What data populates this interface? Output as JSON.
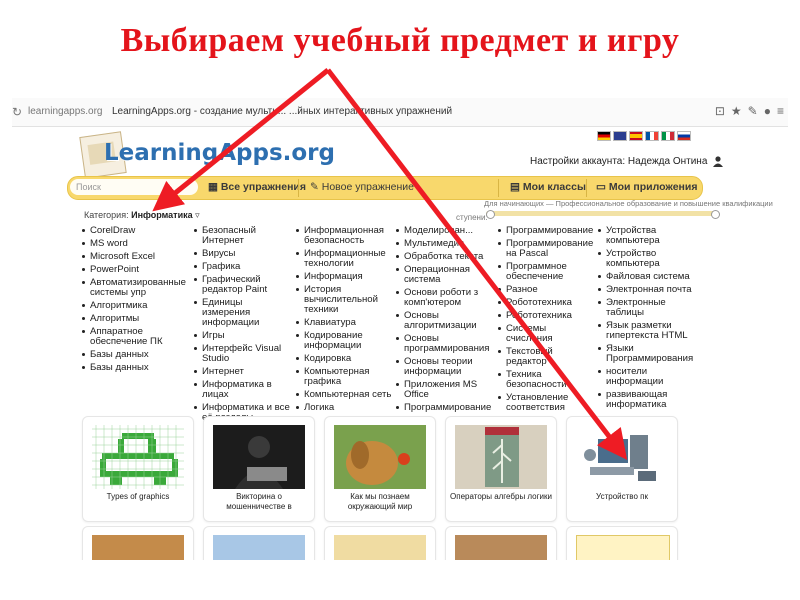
{
  "heading": "Выбираем учебный предмет и игру",
  "browser": {
    "url": "learningapps.org",
    "page_title": "LearningApps.org - создание мульти...",
    "page_title_tail": "...йных интерактивных упражнений"
  },
  "logo": {
    "text": "LearningApps.org"
  },
  "account": {
    "text": "Настройки аккаунта: Надежда Онтина"
  },
  "nav": {
    "search_placeholder": "Поиск",
    "all_exercises": "Все упражнения",
    "new_exercise": "Новое упражнение",
    "my_classes": "Мои классы",
    "my_apps": "Мои приложения"
  },
  "category": {
    "label": "Категория:",
    "value": "Информатика"
  },
  "levels": {
    "label": "Для начинающих — Профессиональное образование и повышение квалификации",
    "stage_label": "ступени:"
  },
  "topics": [
    [
      "CorelDraw",
      "MS word",
      "Microsoft Excel",
      "PowerPoint",
      "Автоматизированные системы упр",
      "Алгоритмика",
      "Алгоритмы",
      "Аппаратное обеспечение ПК",
      "Базы данных",
      "Базы данных"
    ],
    [
      "Безопасный Интернет",
      "Вирусы",
      "Графика",
      "Графический редактор Paint",
      "Единицы измерения информации",
      "Игры",
      "Интерфейс Visual Studio",
      "Интернет",
      "Информатика в лицах",
      "Информатика и все её разделы"
    ],
    [
      "Информационная безопасность",
      "Информационные технологии",
      "Информация",
      "История вычислительной техники",
      "Клавиатура",
      "Кодирование информации",
      "Кодировка",
      "Компьютерная графика",
      "Компьютерная сеть",
      "Логика"
    ],
    [
      "Моделирован...",
      "Мультимедиа",
      "Обработка текста",
      "Операционная система",
      "Основи роботи з комп'ютером",
      "Основы алгоритмизации",
      "Основы программирования",
      "Основы теории информации",
      "Приложения MS Office",
      "Программирование"
    ],
    [
      "Программирование",
      "Программирование на Pascal",
      "Программное обеспечение",
      "Разное",
      "Робототехника",
      "Робототехника",
      "Системы счисления",
      "Текстовый редактор",
      "Техника безопасности",
      "Установление соответствия"
    ],
    [
      "Устройства компьютера",
      "Устройство компьютера",
      "Файловая система",
      "Электронная почта",
      "Электронные таблицы",
      "Язык разметки гипертекста HTML",
      "Языки Программирования",
      "носители информации",
      "развивающая информатика"
    ]
  ],
  "tiles": [
    {
      "caption": "Types of graphics"
    },
    {
      "caption": "Викторина о мошенничестве в"
    },
    {
      "caption": "Как мы познаем окружающий мир"
    },
    {
      "caption": "Операторы алгебры логики"
    },
    {
      "caption": "Устройство пк"
    }
  ],
  "colors": {
    "heading": "#e4141b",
    "arrow": "#ee1c24",
    "navbar": "#f8d86c",
    "logo": "#2d6fb0"
  }
}
